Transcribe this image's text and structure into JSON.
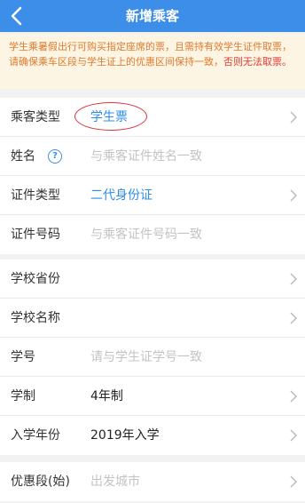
{
  "header": {
    "title": "新增乘客"
  },
  "notice": {
    "text_normal": "学生乘暑假出行可购买指定座席的票，且需持有效学生证件取票，请确保乘车区段与学生证上的优惠区间保持一致，",
    "text_red": "否则无法取票。"
  },
  "passenger": {
    "type_label": "乘客类型",
    "type_value": "学生票",
    "name_label": "姓名",
    "name_placeholder": "与乘客证件姓名一致",
    "id_type_label": "证件类型",
    "id_type_value": "二代身份证",
    "id_number_label": "证件号码",
    "id_number_placeholder": "与乘客证件号码一致"
  },
  "school": {
    "province_label": "学校省份",
    "name_label": "学校名称",
    "student_no_label": "学号",
    "student_no_placeholder": "请与学生证学号一致",
    "duration_label": "学制",
    "duration_value": "4年制",
    "enroll_label": "入学年份",
    "enroll_value": "2019年入学"
  },
  "discount": {
    "start_label": "优惠段(始)",
    "start_placeholder": "出发城市"
  },
  "colors": {
    "header": "#3d8ee8",
    "accent": "#2e8de8",
    "notice_text": "#e07a2e",
    "warning": "#e53935",
    "annotation_circle": "#d9323c"
  },
  "icons": {
    "back": "back-arrow-icon",
    "help": "help-circle-icon",
    "chevron": "chevron-right-icon"
  }
}
